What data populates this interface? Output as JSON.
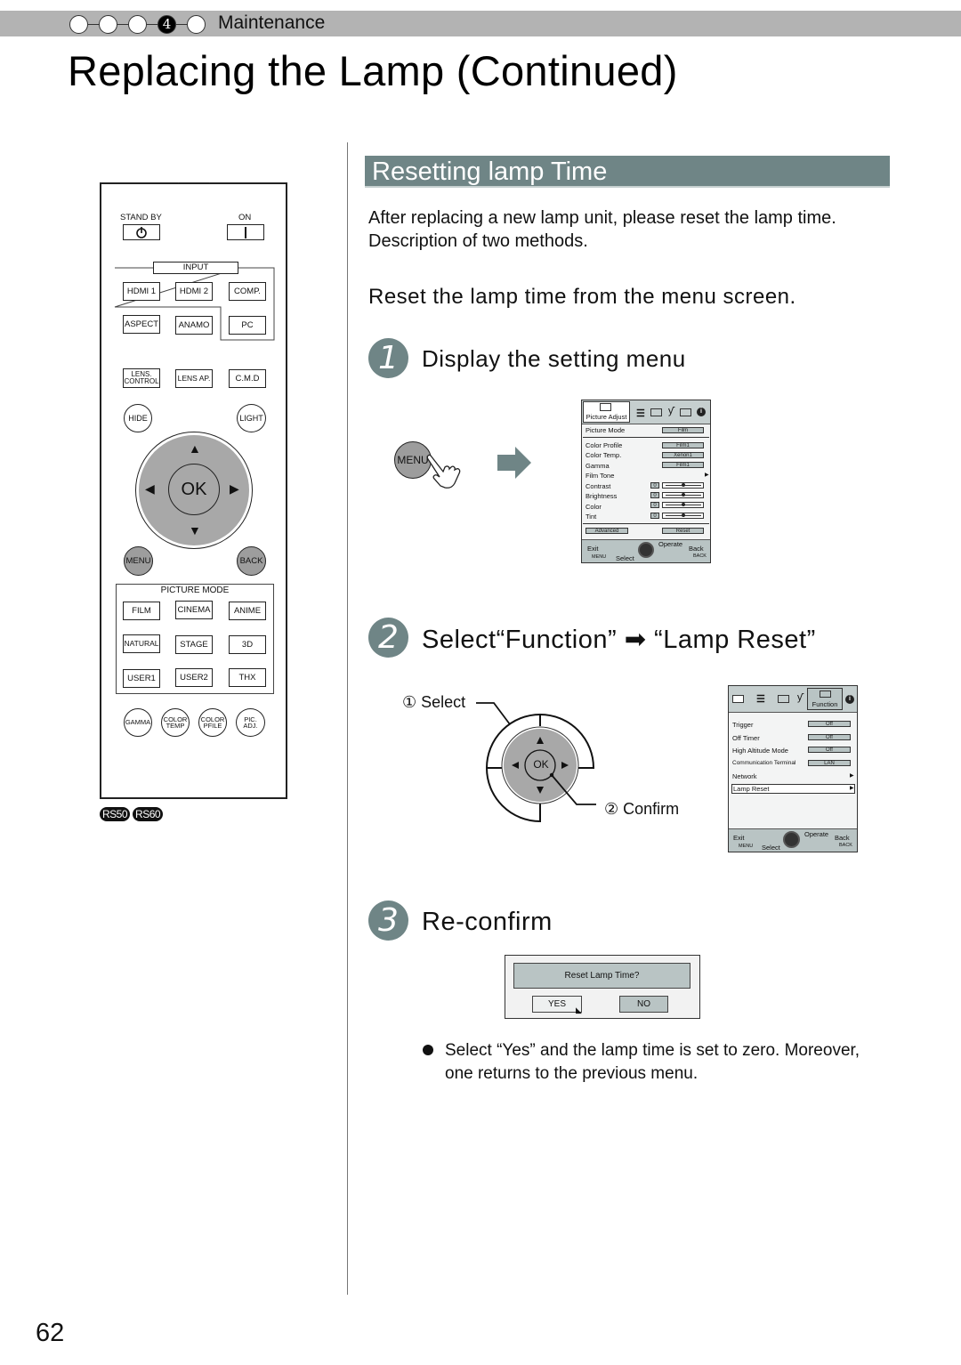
{
  "header": {
    "chapter_steps": [
      "",
      "",
      "",
      "4",
      ""
    ],
    "active_step": 4,
    "chapter_label": "Maintenance",
    "page_title": "Replacing the Lamp (Continued)"
  },
  "remote": {
    "standby_label": "STAND BY",
    "on_label": "ON",
    "input_label": "INPUT",
    "row1": [
      "HDMI 1",
      "HDMI 2",
      "COMP."
    ],
    "row2": [
      "ASPECT",
      "ANAMO",
      "PC"
    ],
    "row3": [
      "LENS. CONTROL",
      "LENS AP.",
      "C.M.D"
    ],
    "hide_label": "HIDE",
    "light_label": "LIGHT",
    "ok_label": "OK",
    "menu_label": "MENU",
    "back_label": "BACK",
    "picture_mode_label": "PICTURE MODE",
    "pm_row1": [
      "FILM",
      "CINEMA",
      "ANIME"
    ],
    "pm_row2": [
      "NATURAL",
      "STAGE",
      "3D"
    ],
    "pm_row3": [
      "USER1",
      "USER2",
      "THX"
    ],
    "round_buttons": [
      "GAMMA",
      "COLOR TEMP",
      "COLOR PFILE",
      "PIC. ADJ."
    ],
    "models": [
      "RS50",
      "RS60"
    ]
  },
  "section": {
    "title": "Resetting lamp Time",
    "intro_line1": "After replacing a new lamp unit, please reset the lamp time.",
    "intro_line2": "Description of two methods.",
    "subhead": "Reset the lamp time from the menu screen."
  },
  "steps": [
    {
      "number": "1",
      "title": "Display the setting menu"
    },
    {
      "number": "2",
      "title": "Select“Function” ➡ “Lamp Reset”"
    },
    {
      "number": "3",
      "title": "Re-confirm"
    }
  ],
  "step1": {
    "menu_button_label": "MENU",
    "menu": {
      "active_tab": "Picture Adjust",
      "rows": [
        {
          "label": "Picture Mode",
          "value": "Film"
        },
        {
          "label": "Color Profile",
          "value": "Film1"
        },
        {
          "label": "Color Temp.",
          "value": "Xenon1"
        },
        {
          "label": "Gamma",
          "value": "Film1"
        },
        {
          "label": "Film Tone",
          "value": ""
        },
        {
          "label": "Contrast",
          "value": "0"
        },
        {
          "label": "Brightness",
          "value": "0"
        },
        {
          "label": "Color",
          "value": "0"
        },
        {
          "label": "Tint",
          "value": "0"
        }
      ],
      "advanced_label": "Advanced",
      "reset_label": "Reset",
      "footer": {
        "exit": "Exit",
        "menu": "MENU",
        "select": "Select",
        "operate": "Operate",
        "back": "Back",
        "back_key": "BACK"
      }
    }
  },
  "step2": {
    "select_label": "① Select",
    "confirm_label": "② Confirm",
    "ok_label": "OK",
    "menu": {
      "active_tab": "Function",
      "rows": [
        {
          "label": "Trigger",
          "value": "Off"
        },
        {
          "label": "Off Timer",
          "value": "Off"
        },
        {
          "label": "High Altitude Mode",
          "value": "Off"
        },
        {
          "label": "Communication Terminal",
          "value": "LAN"
        },
        {
          "label": "Network",
          "value": ""
        },
        {
          "label": "Lamp Reset",
          "value": ""
        }
      ],
      "footer": {
        "exit": "Exit",
        "menu": "MENU",
        "select": "Select",
        "operate": "Operate",
        "back": "Back",
        "back_key": "BACK"
      }
    }
  },
  "step3": {
    "dialog_message": "Reset Lamp Time?",
    "yes_label": "YES",
    "no_label": "NO",
    "note": "Select “Yes” and the lamp time is set to zero. Moreover, one returns to the previous menu."
  },
  "page_number": "62"
}
